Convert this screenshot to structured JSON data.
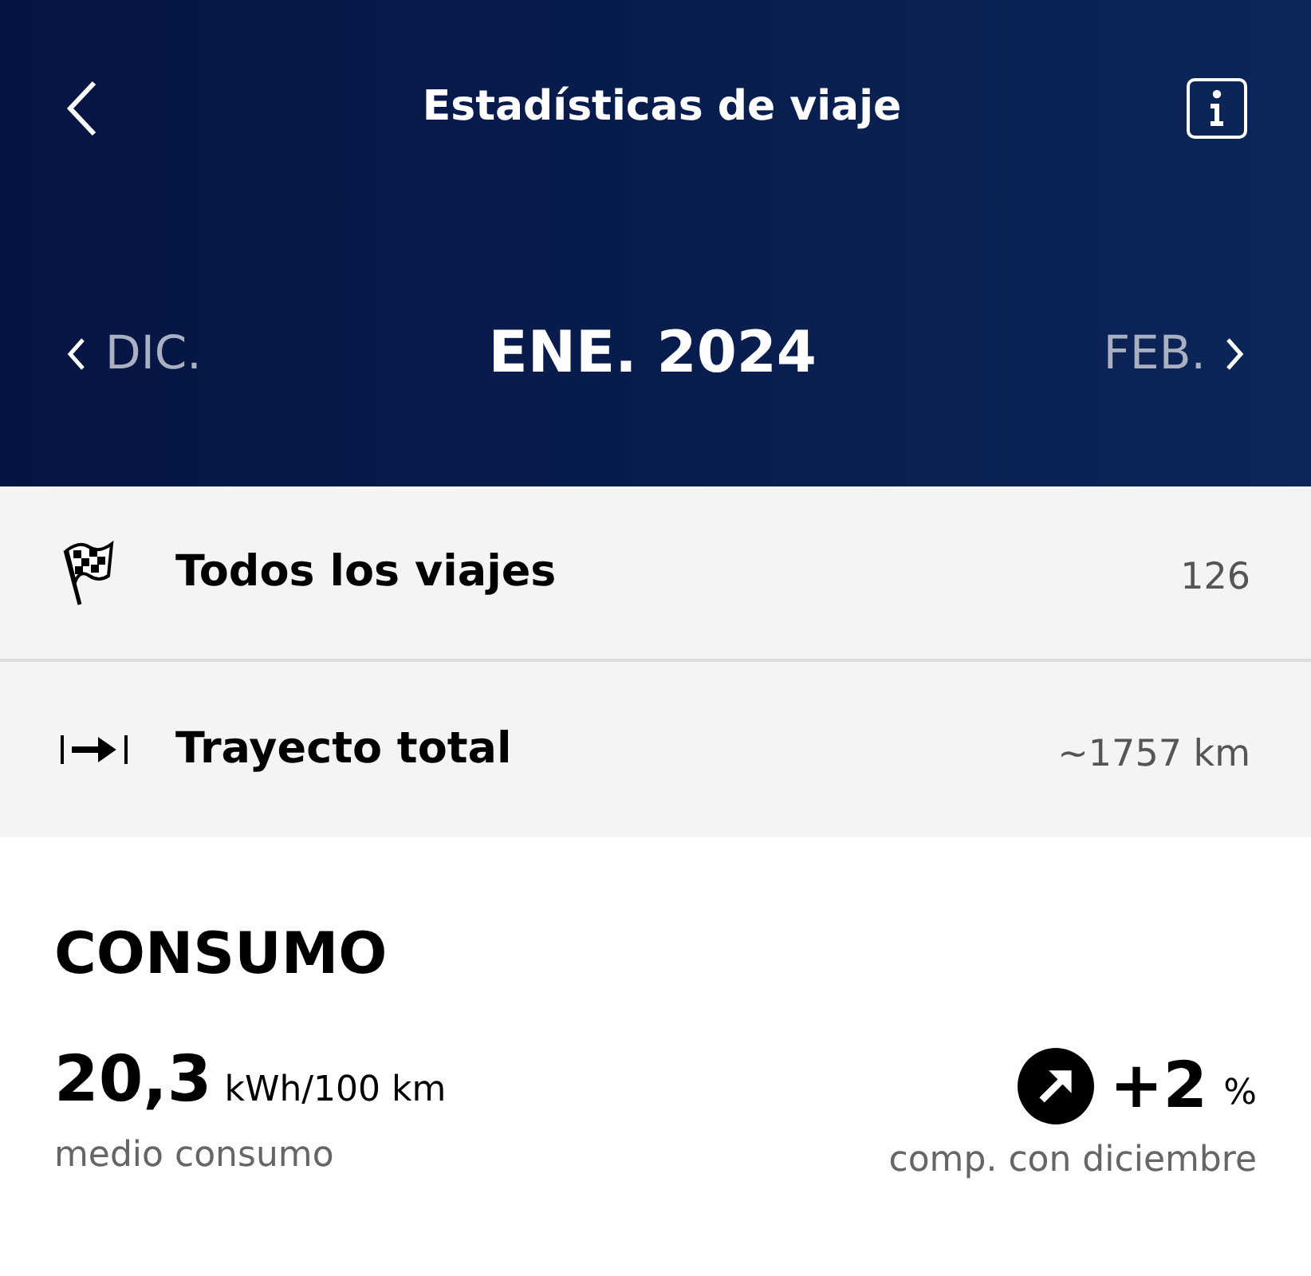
{
  "header": {
    "title": "Estadísticas de viaje",
    "period": {
      "previous": "DIC.",
      "current": "ENE. 2024",
      "next": "FEB."
    }
  },
  "stats": [
    {
      "kind": "trips",
      "label": "Todos los viajes",
      "value": "126"
    },
    {
      "kind": "distance",
      "label": "Trayecto total",
      "value": "~1757 km"
    }
  ],
  "consumption": {
    "title": "CONSUMO",
    "value": "20,3",
    "unit": "kWh/100 km",
    "caption": "medio consumo",
    "comparison": {
      "kind": "increase",
      "value": "+2",
      "unit": "%",
      "caption": "comp. con diciembre"
    }
  }
}
